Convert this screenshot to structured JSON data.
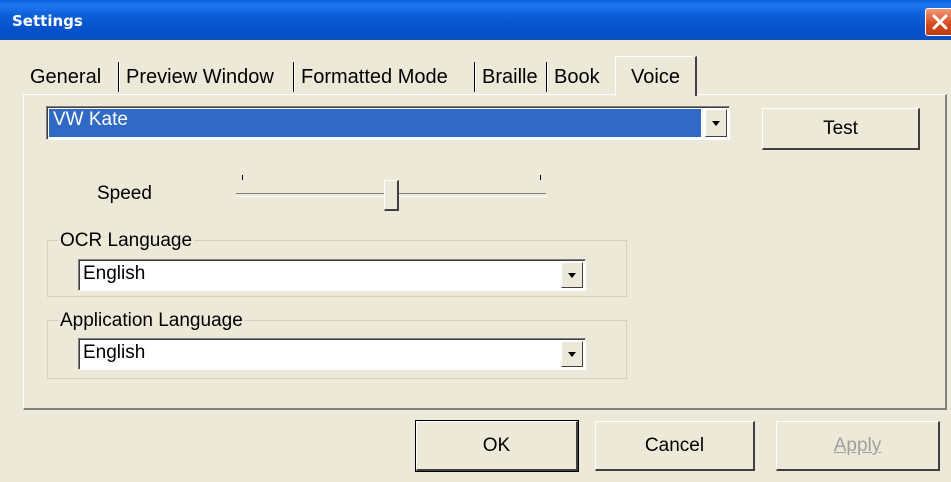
{
  "window": {
    "title": "Settings",
    "close_icon": "close-icon"
  },
  "tabs": [
    {
      "label": "General",
      "active": false
    },
    {
      "label": "Preview Window",
      "active": false
    },
    {
      "label": "Formatted Mode",
      "active": false
    },
    {
      "label": "Braille",
      "active": false
    },
    {
      "label": "Book",
      "active": false
    },
    {
      "label": "Voice",
      "active": true
    }
  ],
  "voice": {
    "selected_voice": "VW Kate",
    "test_label": "Test",
    "speed_label": "Speed",
    "speed_value": 0.5
  },
  "ocr_language": {
    "group_label": "OCR Language",
    "value": "English"
  },
  "app_language": {
    "group_label": "Application Language",
    "value": "English"
  },
  "footer": {
    "ok_label": "OK",
    "cancel_label": "Cancel",
    "apply_label": "Apply",
    "apply_enabled": false
  },
  "colors": {
    "titlebar": "#0550c8",
    "selection": "#316ac5",
    "dialog_bg": "#ece9d8",
    "close_button": "#d4491e"
  }
}
